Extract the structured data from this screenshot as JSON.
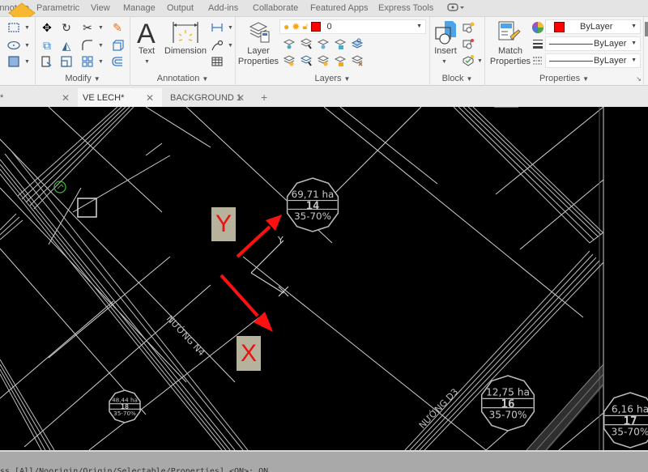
{
  "ribbon_tabs": [
    "Annotate",
    "Parametric",
    "View",
    "Manage",
    "Output",
    "Add-ins",
    "Collaborate",
    "Featured Apps",
    "Express Tools"
  ],
  "ribbon": {
    "modify": {
      "title": "Modify"
    },
    "annotation": {
      "title": "Annotation",
      "text_label": "Text",
      "dimension_label": "Dimension"
    },
    "layers": {
      "title": "Layers",
      "layer_properties_label_1": "Layer",
      "layer_properties_label_2": "Properties",
      "current_layer": "0"
    },
    "block": {
      "title": "Block",
      "insert_label": "Insert"
    },
    "properties": {
      "title": "Properties",
      "match_label_1": "Match",
      "match_label_2": "Properties",
      "color_value": "ByLayer",
      "lineweight_value": "ByLayer",
      "linetype_value": "ByLayer",
      "color_hex": "#ff0000"
    }
  },
  "doc_tabs": [
    {
      "label": "*",
      "active": false
    },
    {
      "label": "VE LECH*",
      "active": true
    },
    {
      "label": "BACKGROUND 1",
      "active": false
    }
  ],
  "canvas": {
    "axis_labels": {
      "y": "Y",
      "x": "X"
    },
    "ucs_y_text": "Y",
    "lots": [
      {
        "area": "69,71 ha",
        "number": "14",
        "density": "35-70%"
      },
      {
        "area": "48,44 ha",
        "number": "18",
        "density": "35-70%"
      },
      {
        "area": "12,75 ha",
        "number": "16",
        "density": "35-70%"
      },
      {
        "area": "6,16 ha",
        "number": "17",
        "density": "35-70%"
      }
    ],
    "street_labels": [
      "NƯỚNG N4",
      "NƯỚNG D3"
    ],
    "arrow_color": "#ff1010"
  },
  "command_line": {
    "text": "ss [All/Noorigin/Origin/Selectable/Properties] <ON>: ON"
  }
}
